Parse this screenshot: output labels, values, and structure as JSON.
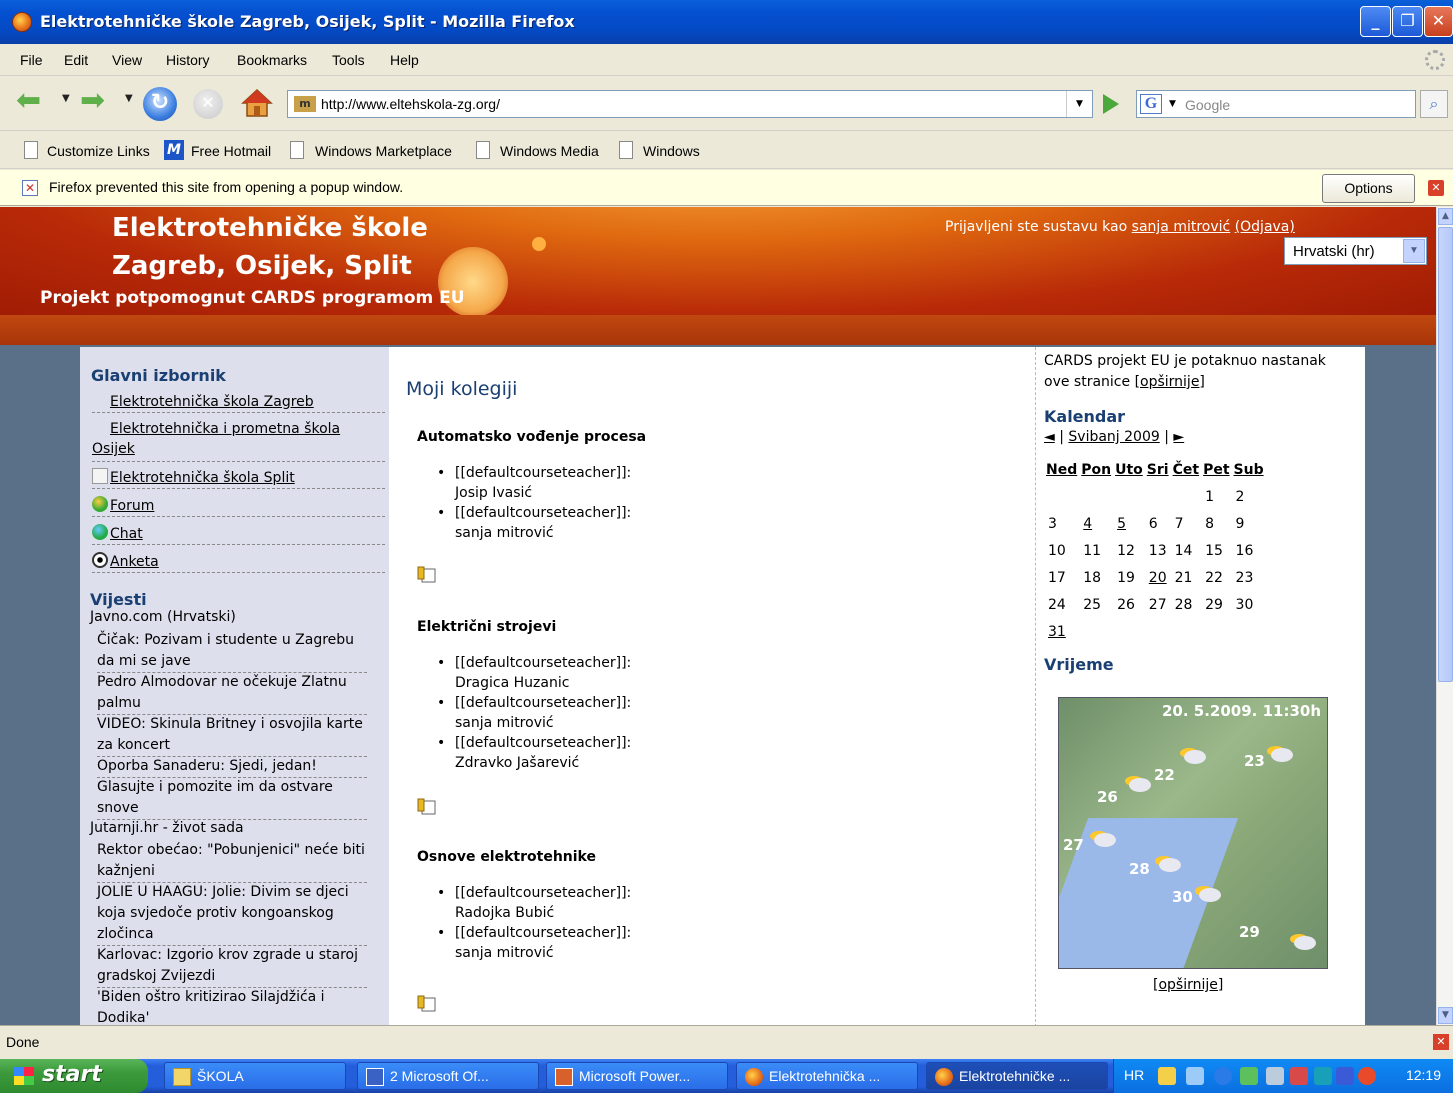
{
  "window": {
    "title": "Elektrotehničke škole Zagreb, Osijek, Split - Mozilla Firefox"
  },
  "menu": [
    "File",
    "Edit",
    "View",
    "History",
    "Bookmarks",
    "Tools",
    "Help"
  ],
  "navbar": {
    "url": "http://www.eltehskola-zg.org/",
    "search_placeholder": "Google"
  },
  "bookmarks": [
    "Customize Links",
    "Free Hotmail",
    "Windows Marketplace",
    "Windows Media",
    "Windows"
  ],
  "notice": {
    "message": "Firefox prevented this site from opening a popup window.",
    "options_label": "Options"
  },
  "site": {
    "title_line1": "Elektrotehničke škole",
    "title_line2": "Zagreb, Osijek, Split",
    "subtitle": "Projekt potpomognut CARDS programom EU",
    "login_prefix": "Prijavljeni ste sustavu kao ",
    "login_user": "sanja mitrović",
    "logout": "(Odjava)",
    "language": "Hrvatski (hr)"
  },
  "left": {
    "main_menu_title": "Glavni izbornik",
    "menu_items": [
      "Elektrotehnička škola Zagreb",
      "Elektrotehnička i prometna škola Osijek",
      "Elektrotehnička škola Split",
      "Forum",
      "Chat",
      "Anketa"
    ],
    "news_title": "Vijesti",
    "source1": "Javno.com (Hrvatski)",
    "news1": [
      "Čičak: Pozivam i studente u Zagrebu da mi se jave",
      "Pedro Almodovar ne očekuje Zlatnu palmu",
      "VIDEO: Skinula Britney i osvojila karte za koncert",
      "Oporba Sanaderu: Sjedi, jedan!",
      "Glasujte i pomozite im da ostvare snove"
    ],
    "source2": "Jutarnji.hr - život sada",
    "news2": [
      "Rektor obećao: \"Pobunjenici\" neće biti kažnjeni",
      "JOLIE U HAAGU: Jolie: Divim se djeci koja svjedoče protiv kongoanskog zločinca",
      "Karlovac: Izgorio krov zgrade u staroj gradskoj Zvijezdi",
      "'Biden oštro kritizirao Silajdžića i Dodika'"
    ]
  },
  "main": {
    "heading": "Moji kolegiji",
    "courses": [
      {
        "name": "Automatsko vođenje procesa",
        "teachers": [
          {
            "role": "[[defaultcourseteacher]]:",
            "name": "Josip Ivasić"
          },
          {
            "role": "[[defaultcourseteacher]]:",
            "name": "sanja mitrović"
          }
        ]
      },
      {
        "name": "Električni strojevi",
        "teachers": [
          {
            "role": "[[defaultcourseteacher]]:",
            "name": "Dragica Huzanic"
          },
          {
            "role": "[[defaultcourseteacher]]:",
            "name": "sanja mitrović"
          },
          {
            "role": "[[defaultcourseteacher]]:",
            "name": "Zdravko Jašarević"
          }
        ]
      },
      {
        "name": "Osnove elektrotehnike",
        "teachers": [
          {
            "role": "[[defaultcourseteacher]]:",
            "name": "Radojka Bubić"
          },
          {
            "role": "[[defaultcourseteacher]]:",
            "name": "sanja mitrović"
          }
        ]
      }
    ]
  },
  "right": {
    "cards_text": "CARDS projekt EU je potaknuo nastanak ove stranice",
    "more": "[opširnije]",
    "calendar_title": "Kalendar",
    "month_prev": "◄",
    "month_sep": "|",
    "month": "Svibanj 2009",
    "month_next": "►",
    "weekdays": [
      "Ned",
      "Pon",
      "Uto",
      "Sri",
      "Čet",
      "Pet",
      "Sub"
    ],
    "weeks": [
      [
        "",
        "",
        "",
        "",
        "",
        "1",
        "2"
      ],
      [
        "3",
        "4",
        "5",
        "6",
        "7",
        "8",
        "9"
      ],
      [
        "10",
        "11",
        "12",
        "13",
        "14",
        "15",
        "16"
      ],
      [
        "17",
        "18",
        "19",
        "20",
        "21",
        "22",
        "23"
      ],
      [
        "24",
        "25",
        "26",
        "27",
        "28",
        "29",
        "30"
      ],
      [
        "31",
        "",
        "",
        "",
        "",
        "",
        ""
      ]
    ],
    "linked_days": [
      "4",
      "5",
      "20",
      "31"
    ],
    "weather_title": "Vrijeme",
    "weather_stamp": "20. 5.2009. 11:30h",
    "weather_temps": [
      "23",
      "22",
      "26",
      "27",
      "28",
      "30",
      "29"
    ],
    "weather_more": "[opširnije]"
  },
  "status": {
    "text": "Done"
  },
  "taskbar": {
    "start": "start",
    "tasks": [
      "ŠKOLA",
      "2 Microsoft Of...",
      "Microsoft Power...",
      "Elektrotehnička ...",
      "Elektrotehničke ..."
    ],
    "language": "HR",
    "clock": "12:19"
  }
}
